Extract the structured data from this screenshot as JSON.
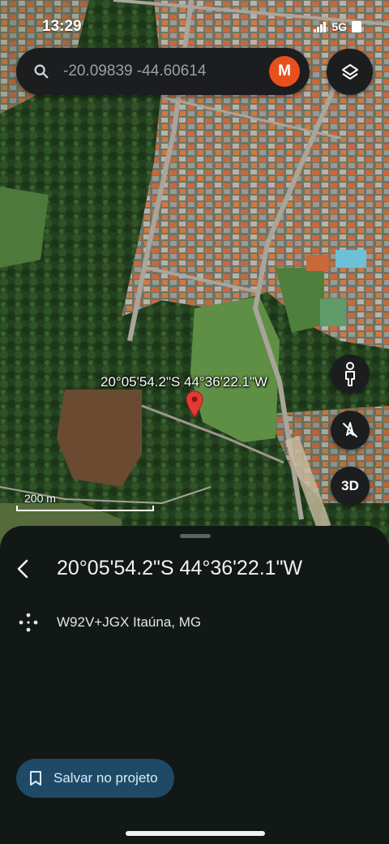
{
  "status_bar": {
    "time": "13:29",
    "network": "5G"
  },
  "search": {
    "value": "",
    "placeholder": "-20.09839 -44.60614",
    "avatar_letter": "M"
  },
  "map": {
    "pin_label": "20°05'54.2\"S 44°36'22.1\"W",
    "scale_label": "200 m",
    "three_d_label": "3D"
  },
  "sheet": {
    "title": "20°05'54.2\"S 44°36'22.1\"W",
    "plus_code": "W92V+JGX Itaúna, MG",
    "save_label": "Salvar no projeto"
  },
  "icons": {
    "search": "search-icon",
    "layers": "layers-icon",
    "pegman": "pegman-icon",
    "compass": "compass-off-icon",
    "back": "back-arrow-icon",
    "plus_code": "plus-code-icon",
    "bookmark": "bookmark-icon",
    "pin": "map-pin-icon"
  },
  "colors": {
    "avatar": "#e8501b",
    "pin": "#e53935",
    "save_button": "#1f4a66",
    "sheet": "#121815"
  }
}
